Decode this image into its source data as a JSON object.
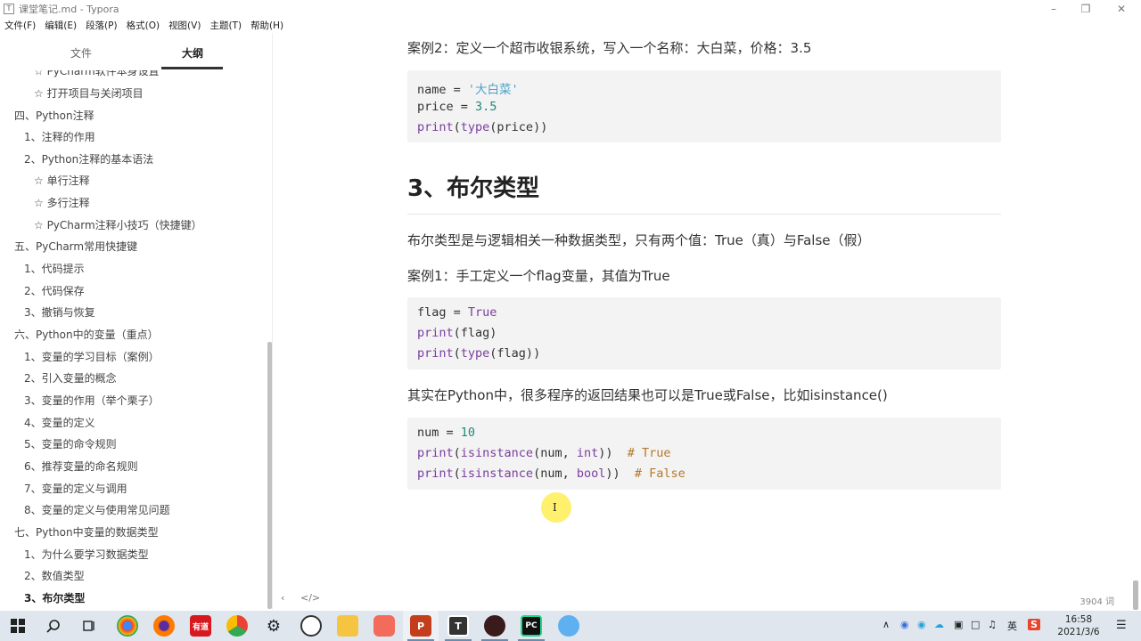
{
  "window": {
    "title": "课堂笔记.md - Typora"
  },
  "menu": [
    "文件(F)",
    "编辑(E)",
    "段落(P)",
    "格式(O)",
    "视图(V)",
    "主题(T)",
    "帮助(H)"
  ],
  "sidebar": {
    "tab_files": "文件",
    "tab_outline": "大纲",
    "items": [
      {
        "label": "☆ PyCharm软件本身设置",
        "level": 3
      },
      {
        "label": "☆ 打开项目与关闭项目",
        "level": 3
      },
      {
        "label": "四、Python注释",
        "level": 1
      },
      {
        "label": "1、注释的作用",
        "level": 2
      },
      {
        "label": "2、Python注释的基本语法",
        "level": 2
      },
      {
        "label": "☆ 单行注释",
        "level": 3
      },
      {
        "label": "☆ 多行注释",
        "level": 3
      },
      {
        "label": "☆ PyCharm注释小技巧（快捷键）",
        "level": 3
      },
      {
        "label": "五、PyCharm常用快捷键",
        "level": 1
      },
      {
        "label": "1、代码提示",
        "level": 2
      },
      {
        "label": "2、代码保存",
        "level": 2
      },
      {
        "label": "3、撤销与恢复",
        "level": 2
      },
      {
        "label": "六、Python中的变量（重点）",
        "level": 1
      },
      {
        "label": "1、变量的学习目标（案例）",
        "level": 2
      },
      {
        "label": "2、引入变量的概念",
        "level": 2
      },
      {
        "label": "3、变量的作用（举个栗子）",
        "level": 2
      },
      {
        "label": "4、变量的定义",
        "level": 2
      },
      {
        "label": "5、变量的命令规则",
        "level": 2
      },
      {
        "label": "6、推荐变量的命名规则",
        "level": 2
      },
      {
        "label": "7、变量的定义与调用",
        "level": 2
      },
      {
        "label": "8、变量的定义与使用常见问题",
        "level": 2
      },
      {
        "label": "七、Python中变量的数据类型",
        "level": 1
      },
      {
        "label": "1、为什么要学习数据类型",
        "level": 2
      },
      {
        "label": "2、数值类型",
        "level": 2
      },
      {
        "label": "3、布尔类型",
        "level": 2,
        "active": true
      }
    ]
  },
  "editor": {
    "case2_text": "案例2：定义一个超市收银系统，写入一个名称：大白菜，价格：3.5",
    "code1": {
      "l1_a": "name ",
      "l1_op": "=",
      "l1_str": " '大白菜'",
      "l2_a": "price ",
      "l2_op": "=",
      "l2_num": " 3.5",
      "l3_fn": "print",
      "l3_p1": "(",
      "l3_fn2": "type",
      "l3_rest": "(price))"
    },
    "heading": "3、布尔类型",
    "bool_desc": "布尔类型是与逻辑相关一种数据类型，只有两个值：True（真）与False（假）",
    "case1_text": "案例1：手工定义一个flag变量，其值为True",
    "code2": {
      "l1_a": "flag ",
      "l1_op": "=",
      "l1_kw": " True",
      "l2_fn": "print",
      "l2_rest": "(flag)",
      "l3_fn": "print",
      "l3_p1": "(",
      "l3_fn2": "type",
      "l3_rest": "(flag))"
    },
    "python_text": "其实在Python中，很多程序的返回结果也可以是True或False，比如isinstance()",
    "code3": {
      "l1_a": "num ",
      "l1_op": "=",
      "l1_num": " 10",
      "l2_fn": "print",
      "l2_p1": "(",
      "l2_fn2": "isinstance",
      "l2_mid": "(num, ",
      "l2_kw": "int",
      "l2_end": "))  ",
      "l2_cm": "# True",
      "l3_fn": "print",
      "l3_p1": "(",
      "l3_fn2": "isinstance",
      "l3_mid": "(num, ",
      "l3_kw": "bool",
      "l3_end": "))  ",
      "l3_cm": "# False"
    }
  },
  "footer": {
    "collapse": "‹",
    "source": "</>",
    "word_count": "3904 词"
  },
  "taskbar": {
    "youdao": "有道",
    "ppt": "P",
    "typora": "T",
    "pycharm": "PC",
    "ime": "英",
    "time": "16:58",
    "date": "2021/3/6"
  }
}
